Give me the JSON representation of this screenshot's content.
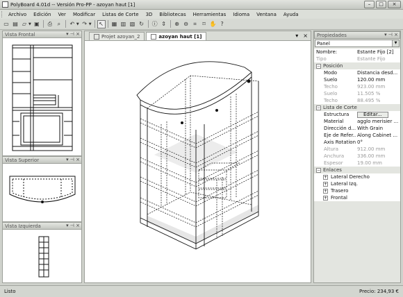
{
  "window": {
    "title": "PolyBoard 4.01d -- Versión Pro-PP - azoyan haut [1]"
  },
  "menu": [
    "Archivo",
    "Edición",
    "Ver",
    "Modificar",
    "Listas de Corte",
    "3D",
    "Bibliotecas",
    "Herramientas",
    "Idioma",
    "Ventana",
    "Ayuda"
  ],
  "panels": {
    "front": {
      "title": "Vista Frontal"
    },
    "top": {
      "title": "Vista Superior"
    },
    "left": {
      "title": "Vista Izquierda"
    },
    "pin": "▾ ⊣ ×"
  },
  "tabs": [
    {
      "label": "Projet azoyan_2",
      "active": false
    },
    {
      "label": "azoyan haut [1]",
      "active": true
    }
  ],
  "tab_controls": {
    "dropdown": "▾",
    "close": "×"
  },
  "properties": {
    "title": "Propiedades",
    "selector": "Panel",
    "header_rows": [
      {
        "key": "Nombre:",
        "value": "Estante Fijo [2]",
        "dim": false
      },
      {
        "key": "Tipo",
        "value": "Estante Fijo",
        "dim": true
      }
    ],
    "posicion": {
      "label": "Posición",
      "rows": [
        {
          "key": "Modo",
          "value": "Distancia desd...",
          "dim": false
        },
        {
          "key": "Suelo",
          "value": "120.00 mm",
          "dim": false
        },
        {
          "key": "Techo",
          "value": "923.00 mm",
          "dim": true
        },
        {
          "key": "Suelo",
          "value": "11.505 %",
          "dim": true
        },
        {
          "key": "Techo",
          "value": "88.495 %",
          "dim": true
        }
      ]
    },
    "lista_corte": {
      "label": "Lista de Corte",
      "estructura_key": "Estructura",
      "estructura_button": "Editar...",
      "rows": [
        {
          "key": "Material",
          "value": "agglo merisier ...",
          "dim": false
        },
        {
          "key": "Dirección d...",
          "value": "With Grain",
          "dim": false
        },
        {
          "key": "Eje de Refer...",
          "value": "Along Cabinet ...",
          "dim": false
        },
        {
          "key": "Axis Rotation",
          "value": "0°",
          "dim": false
        },
        {
          "key": "Altura",
          "value": "912.00 mm",
          "dim": true
        },
        {
          "key": "Anchura",
          "value": "336.00 mm",
          "dim": true
        },
        {
          "key": "Espesor",
          "value": "19.00 mm",
          "dim": true
        }
      ]
    },
    "enlaces": {
      "label": "Enlaces",
      "items": [
        "Lateral Derecho",
        "Lateral Izq.",
        "Trasero",
        "Frontal"
      ]
    }
  },
  "status": {
    "left": "Listo",
    "price": "Precio: 234,93 €"
  },
  "window_buttons": {
    "minimize": "–",
    "maximize": "□",
    "close": "×"
  }
}
